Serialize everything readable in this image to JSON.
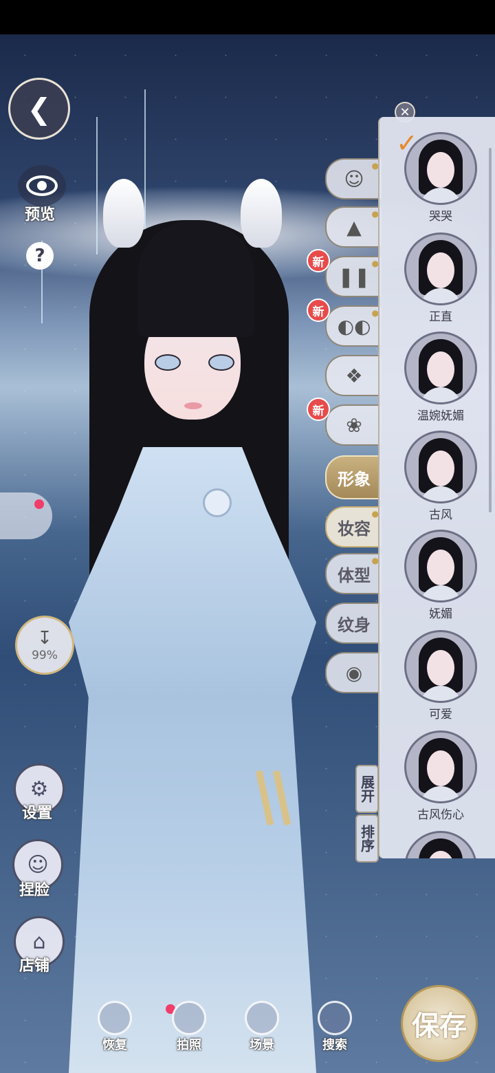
{
  "left_controls": {
    "back_icon": "butterfly-back-icon",
    "preview_label": "预览",
    "help_label": "?",
    "download_progress": "99%",
    "settings_label": "设置",
    "pinch_face_label": "捏脸",
    "shop_label": "店铺"
  },
  "category_tabs": {
    "new_badge": "新",
    "appearance": "形象",
    "makeup": "妆容",
    "body": "体型",
    "tattoo": "纹身"
  },
  "preset_panel": {
    "close_icon": "close-icon",
    "selected_index": 0,
    "presets": [
      {
        "name": "哭哭"
      },
      {
        "name": "正直"
      },
      {
        "name": "温婉妩媚"
      },
      {
        "name": "古风"
      },
      {
        "name": "妩媚"
      },
      {
        "name": "可爱"
      },
      {
        "name": "古风伤心"
      }
    ],
    "expand_label": "展开",
    "sort_label": "排序"
  },
  "bottom_bar": {
    "restore_label": "恢复",
    "photo_label": "拍照",
    "scene_label": "场景",
    "search_label": "搜索",
    "save_label": "保存"
  }
}
